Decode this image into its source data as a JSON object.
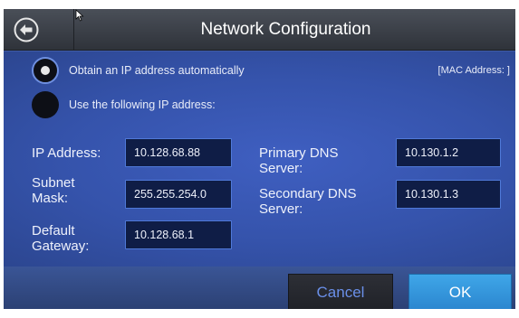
{
  "header": {
    "title": "Network Configuration",
    "back_icon": "back-arrow-icon"
  },
  "options": {
    "auto_label": "Obtain an IP address automatically",
    "auto_selected": true,
    "manual_label": "Use the following IP address:",
    "manual_selected": false
  },
  "mac": "[MAC Address: ]",
  "fields": {
    "ip_label": "IP Address:",
    "ip_value": "10.128.68.88",
    "subnet_label_1": "Subnet",
    "subnet_label_2": "Mask:",
    "subnet_value": "255.255.254.0",
    "gateway_label_1": "Default",
    "gateway_label_2": "Gateway:",
    "gateway_value": "10.128.68.1",
    "primary_dns_label_1": "Primary DNS",
    "primary_dns_label_2": "Server:",
    "primary_dns_value": "10.130.1.2",
    "secondary_dns_label_1": "Secondary DNS",
    "secondary_dns_label_2": "Server:",
    "secondary_dns_value": "10.130.1.3"
  },
  "footer": {
    "cancel_label": "Cancel",
    "ok_label": "OK"
  },
  "colors": {
    "background": "#3e5aa6",
    "header": "#3a3e46",
    "field_border": "#4f79d8",
    "accent_cancel_text": "#6a8fe8",
    "ok_button": "#3a9de0"
  }
}
